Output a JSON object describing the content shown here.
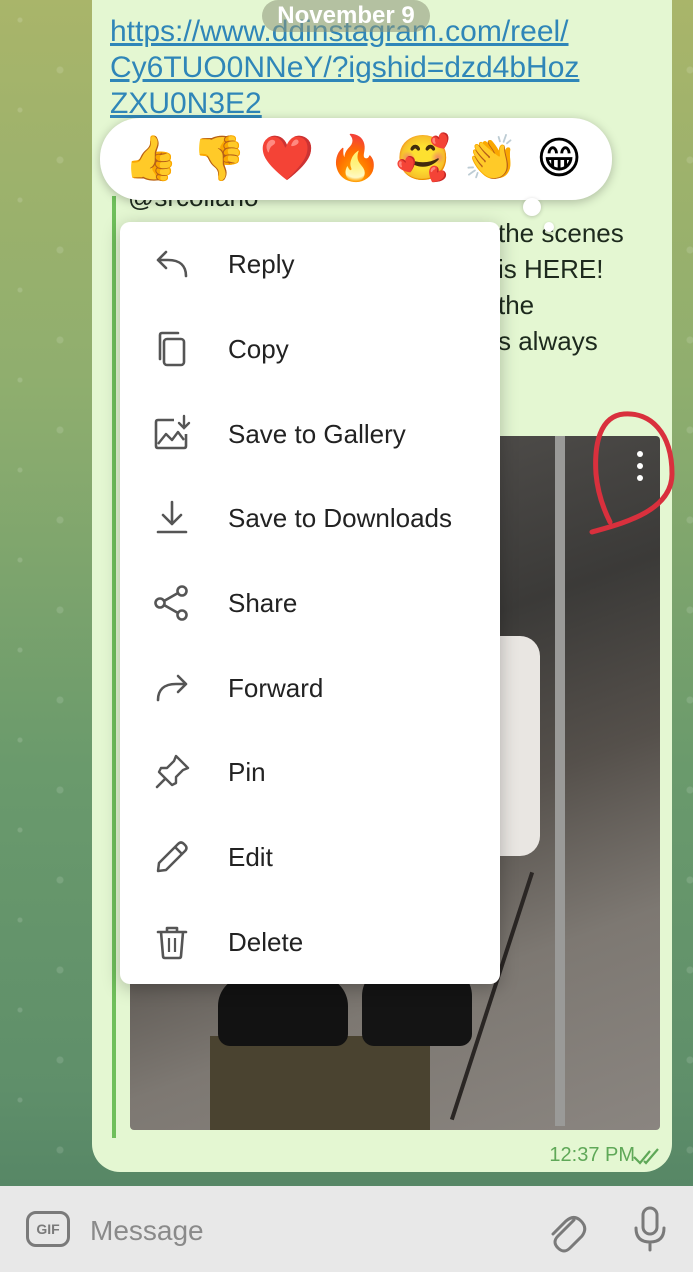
{
  "header": {
    "date_label": "November 9"
  },
  "message": {
    "link": "https://www.ddinstagram.com/reel/Cy6TUO0NNeY/?igshid=dzd4bHozZXU0N3E2",
    "snippet_lines": [
      "@srcoliano",
      "the scenes",
      "is HERE!",
      "the",
      "s always"
    ],
    "time": "12:37 PM",
    "status_icon": "double-check-icon"
  },
  "reactions": [
    "👍",
    "👎",
    "❤️",
    "🔥",
    "🥰",
    "👏",
    "😁"
  ],
  "context_menu": {
    "items": [
      {
        "label": "Reply",
        "icon": "reply-icon"
      },
      {
        "label": "Copy",
        "icon": "copy-icon"
      },
      {
        "label": "Save to Gallery",
        "icon": "save-gallery-icon"
      },
      {
        "label": "Save to Downloads",
        "icon": "download-icon"
      },
      {
        "label": "Share",
        "icon": "share-icon"
      },
      {
        "label": "Forward",
        "icon": "forward-icon"
      },
      {
        "label": "Pin",
        "icon": "pin-icon"
      },
      {
        "label": "Edit",
        "icon": "edit-icon"
      },
      {
        "label": "Delete",
        "icon": "trash-icon"
      }
    ]
  },
  "input_bar": {
    "gif_label": "GIF",
    "placeholder": "Message",
    "attach_icon": "paperclip-icon",
    "mic_icon": "microphone-icon"
  },
  "colors": {
    "bubble": "#e4f7d2",
    "link": "#2f86b8",
    "annotation": "#d9303d",
    "accent": "#5fa858"
  }
}
